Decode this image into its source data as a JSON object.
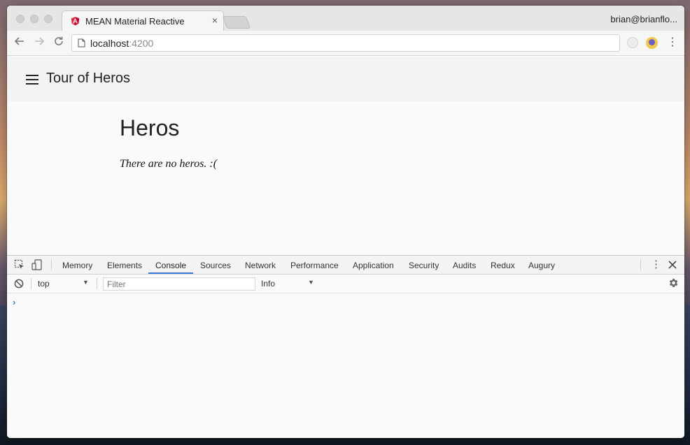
{
  "browser": {
    "tab": {
      "title": "MEAN Material Reactive",
      "close_label": "×",
      "favicon": "angular-icon"
    },
    "user_name": "brian@brianflo...",
    "address": {
      "host": "localhost",
      "port": ":4200"
    }
  },
  "app": {
    "title": "Tour of Heros",
    "heading": "Heros",
    "empty_message": "There are no heros. :("
  },
  "devtools": {
    "tabs": [
      "Memory",
      "Elements",
      "Console",
      "Sources",
      "Network",
      "Performance",
      "Application",
      "Security",
      "Audits",
      "Redux",
      "Augury"
    ],
    "active_tab": "Console",
    "context": "top",
    "filter_placeholder": "Filter",
    "level": "Info",
    "prompt": "›"
  },
  "colors": {
    "accent": "#3879d9",
    "angular_red": "#dd2c3c"
  }
}
